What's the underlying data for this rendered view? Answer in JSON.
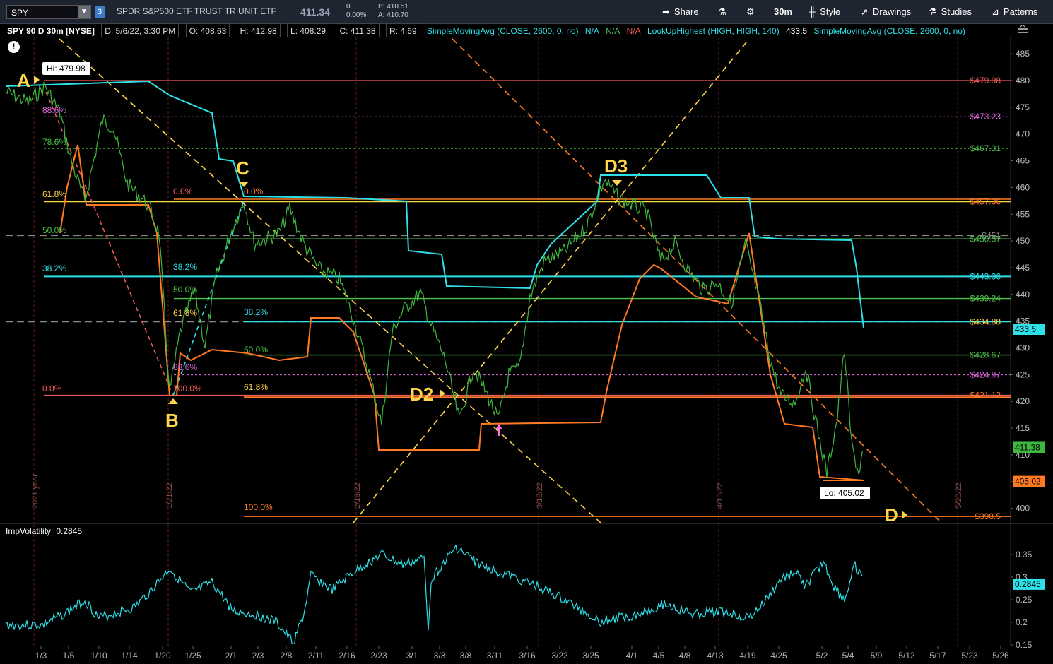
{
  "header": {
    "symbol": "SPY",
    "description": "SPDR S&P500 ETF TRUST TR UNIT ETF",
    "last_price": "411.34",
    "change": "0",
    "change_pct": "0.00%",
    "bid": "B: 410.51",
    "ask": "A: 410.70",
    "timeframe": "30m",
    "share_label": "Share",
    "style_label": "Style",
    "drawings_label": "Drawings",
    "studies_label": "Studies",
    "patterns_label": "Patterns"
  },
  "legend": {
    "chart_id": "SPY 90 D 30m [NYSE]",
    "date": "D: 5/6/22, 3:30 PM",
    "open": "O: 408.63",
    "high": "H: 412.98",
    "low": "L: 408.29",
    "close": "C: 411.38",
    "range": "R: 4.69",
    "sma1": "SimpleMovingAvg (CLOSE, 2600, 0, no)",
    "na1": "N/A",
    "na2": "N/A",
    "na3": "N/A",
    "lookup": "LookUpHighest (HIGH, HIGH, 140)",
    "lookup_val": "433.5",
    "sma2": "SimpleMovingAvg (CLOSE, 2600, 0, no)"
  },
  "colors": {
    "price_green": "#3fb73f",
    "price_orange": "#ff7a22",
    "cyan": "#2ee0e8",
    "yellow": "#ffd54a",
    "red_line": "#f05a5a",
    "magenta": "#e66be6",
    "green_line": "#4cc24c",
    "grid": "#2a2a2a"
  },
  "y_axis_ticks": [
    "485",
    "480",
    "475",
    "470",
    "465",
    "460",
    "455",
    "450",
    "445",
    "440",
    "435",
    "430",
    "425",
    "420",
    "415",
    "410",
    "405",
    "400"
  ],
  "x_axis_ticks": [
    "1/3",
    "1/5",
    "1/10",
    "1/14",
    "1/20",
    "1/25",
    "2/1",
    "2/3",
    "2/8",
    "2/11",
    "2/16",
    "2/23",
    "3/1",
    "3/3",
    "3/8",
    "3/11",
    "3/16",
    "3/22",
    "3/25",
    "4/1",
    "4/5",
    "4/8",
    "4/13",
    "4/19",
    "4/25",
    "5/2",
    "5/4",
    "5/9",
    "5/12",
    "5/17",
    "5/23",
    "5/26"
  ],
  "vertical_markers": [
    "2021 year",
    "1/21/22",
    "2/18/22",
    "3/18/22",
    "4/15/22",
    "5/20/22"
  ],
  "price_labels": [
    {
      "text": "$479.98",
      "price": 479.98,
      "color": "#f05a5a"
    },
    {
      "text": "$473.23",
      "price": 473.23,
      "color": "#e66be6"
    },
    {
      "text": "$467.31",
      "price": 467.31,
      "color": "#4cc24c"
    },
    {
      "text": "$457.36",
      "price": 457.36,
      "color": "#ff7a22"
    },
    {
      "text": "$451",
      "price": 451.0,
      "color": "#888888"
    },
    {
      "text": "$450.37",
      "price": 450.37,
      "color": "#4cc24c"
    },
    {
      "text": "$443.36",
      "price": 443.36,
      "color": "#2ee0e8"
    },
    {
      "text": "$439.24",
      "price": 439.24,
      "color": "#4cc24c"
    },
    {
      "text": "$434.88",
      "price": 434.88,
      "color": "#ffd54a"
    },
    {
      "text": "$428.67",
      "price": 428.67,
      "color": "#4cc24c"
    },
    {
      "text": "$424.97",
      "price": 424.97,
      "color": "#e66be6"
    },
    {
      "text": "$421.12",
      "price": 421.12,
      "color": "#ff7a22"
    },
    {
      "text": "$398.5",
      "price": 398.5,
      "color": "#ff7a22"
    }
  ],
  "axis_badges": [
    {
      "text": "433.5",
      "price": 433.5,
      "bg": "#2ee0e8"
    },
    {
      "text": "411.38",
      "price": 411.38,
      "bg": "#3fb73f"
    },
    {
      "text": "405.02",
      "price": 405.02,
      "bg": "#ff7a22"
    }
  ],
  "fib_labels": [
    {
      "text": "88.6%",
      "color": "#e66be6"
    },
    {
      "text": "78.6%",
      "color": "#4cc24c"
    },
    {
      "text": "61.8%",
      "color": "#ffd54a"
    },
    {
      "text": "50.0%",
      "color": "#4cc24c"
    },
    {
      "text": "38.2%",
      "color": "#2ee0e8"
    },
    {
      "text": "0.0%",
      "color": "#f05a5a"
    },
    {
      "text": "0.0%",
      "color": "#f05a5a"
    },
    {
      "text": "0.0%",
      "color": "#ff7a22"
    },
    {
      "text": "38.2%",
      "color": "#2ee0e8"
    },
    {
      "text": "50.0%",
      "color": "#4cc24c"
    },
    {
      "text": "61.8%",
      "color": "#ffd54a"
    },
    {
      "text": "88.6%",
      "color": "#e66be6"
    },
    {
      "text": "100.0%",
      "color": "#f05a5a"
    },
    {
      "text": "38.2%",
      "color": "#2ee0e8"
    },
    {
      "text": "50.0%",
      "color": "#4cc24c"
    },
    {
      "text": "61.8%",
      "color": "#ffd54a"
    },
    {
      "text": "100.0%",
      "color": "#ff7a22"
    }
  ],
  "pattern_points": [
    "A",
    "B",
    "C",
    "D2",
    "D3",
    "D"
  ],
  "hi_label": "Hi: 479.98",
  "lo_label": "Lo: 405.02",
  "imp_volatility": {
    "label": "ImpVolatility",
    "value": "0.2845",
    "axis_ticks": [
      "0.35",
      "0.3",
      "0.25",
      "0.2",
      "0.15"
    ],
    "badge": "0.2845"
  }
}
